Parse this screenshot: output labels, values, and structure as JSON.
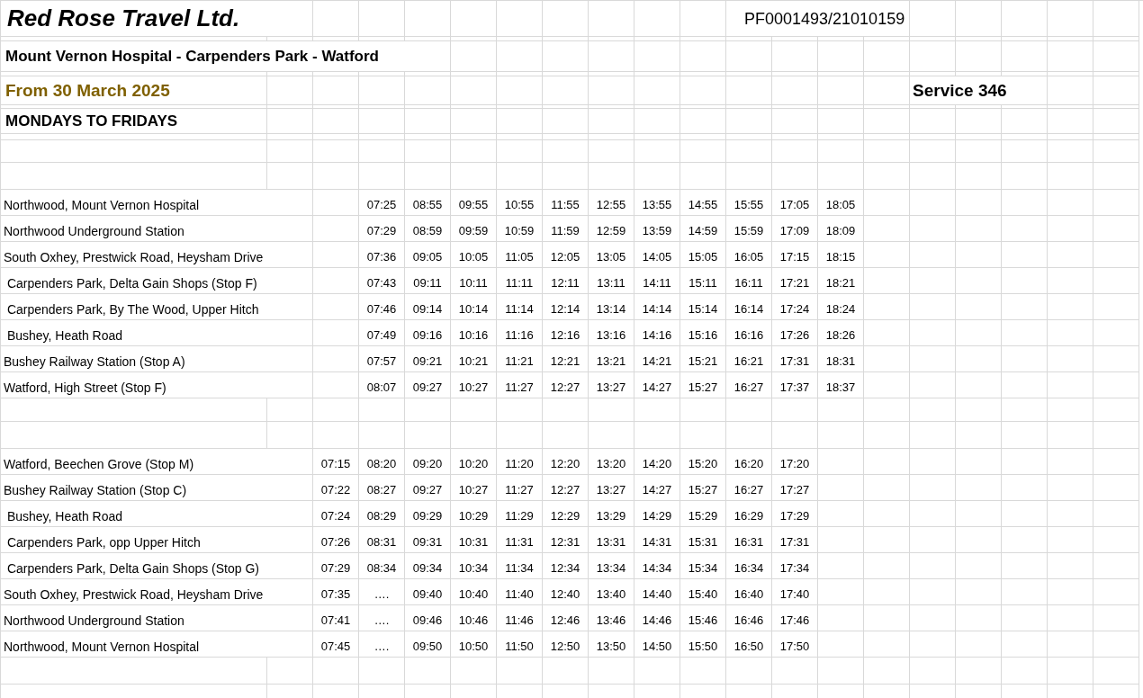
{
  "title": "Red Rose Travel Ltd.",
  "reference": "PF0001493/21010159",
  "route": "Mount Vernon Hospital - Carpenders Park - Watford",
  "effective_date": "From 30 March 2025",
  "service": "Service 346",
  "days": "MONDAYS TO FRIDAYS",
  "sections": [
    {
      "rows": [
        {
          "stop": "Northwood, Mount Vernon Hospital",
          "times": [
            "07:25",
            "08:55",
            "09:55",
            "10:55",
            "11:55",
            "12:55",
            "13:55",
            "14:55",
            "15:55",
            "17:05",
            "18:05"
          ]
        },
        {
          "stop": "Northwood Underground Station",
          "times": [
            "07:29",
            "08:59",
            "09:59",
            "10:59",
            "11:59",
            "12:59",
            "13:59",
            "14:59",
            "15:59",
            "17:09",
            "18:09"
          ]
        },
        {
          "stop": "South Oxhey, Prestwick Road, Heysham Drive",
          "times": [
            "07:36",
            "09:05",
            "10:05",
            "11:05",
            "12:05",
            "13:05",
            "14:05",
            "15:05",
            "16:05",
            "17:15",
            "18:15"
          ]
        },
        {
          "stop": " Carpenders Park, Delta Gain Shops (Stop F)",
          "times": [
            "07:43",
            "09:11",
            "10:11",
            "11:11",
            "12:11",
            "13:11",
            "14:11",
            "15:11",
            "16:11",
            "17:21",
            "18:21"
          ]
        },
        {
          "stop": " Carpenders Park, By The Wood, Upper Hitch",
          "times": [
            "07:46",
            "09:14",
            "10:14",
            "11:14",
            "12:14",
            "13:14",
            "14:14",
            "15:14",
            "16:14",
            "17:24",
            "18:24"
          ]
        },
        {
          "stop": " Bushey, Heath Road",
          "times": [
            "07:49",
            "09:16",
            "10:16",
            "11:16",
            "12:16",
            "13:16",
            "14:16",
            "15:16",
            "16:16",
            "17:26",
            "18:26"
          ]
        },
        {
          "stop": "Bushey Railway Station (Stop A)",
          "times": [
            "07:57",
            "09:21",
            "10:21",
            "11:21",
            "12:21",
            "13:21",
            "14:21",
            "15:21",
            "16:21",
            "17:31",
            "18:31"
          ]
        },
        {
          "stop": "Watford, High Street (Stop F)",
          "times": [
            "08:07",
            "09:27",
            "10:27",
            "11:27",
            "12:27",
            "13:27",
            "14:27",
            "15:27",
            "16:27",
            "17:37",
            "18:37"
          ]
        }
      ]
    },
    {
      "rows": [
        {
          "stop": "Watford, Beechen Grove (Stop M)",
          "times": [
            "07:15",
            "08:20",
            "09:20",
            "10:20",
            "11:20",
            "12:20",
            "13:20",
            "14:20",
            "15:20",
            "16:20",
            "17:20"
          ]
        },
        {
          "stop": "Bushey Railway Station (Stop C)",
          "times": [
            "07:22",
            "08:27",
            "09:27",
            "10:27",
            "11:27",
            "12:27",
            "13:27",
            "14:27",
            "15:27",
            "16:27",
            "17:27"
          ]
        },
        {
          "stop": " Bushey, Heath Road",
          "times": [
            "07:24",
            "08:29",
            "09:29",
            "10:29",
            "11:29",
            "12:29",
            "13:29",
            "14:29",
            "15:29",
            "16:29",
            "17:29"
          ]
        },
        {
          "stop": " Carpenders Park, opp Upper Hitch",
          "times": [
            "07:26",
            "08:31",
            "09:31",
            "10:31",
            "11:31",
            "12:31",
            "13:31",
            "14:31",
            "15:31",
            "16:31",
            "17:31"
          ]
        },
        {
          "stop": " Carpenders Park, Delta Gain Shops (Stop G)",
          "times": [
            "07:29",
            "08:34",
            "09:34",
            "10:34",
            "11:34",
            "12:34",
            "13:34",
            "14:34",
            "15:34",
            "16:34",
            "17:34"
          ]
        },
        {
          "stop": "South Oxhey, Prestwick Road, Heysham Drive",
          "times": [
            "07:35",
            "….",
            "09:40",
            "10:40",
            "11:40",
            "12:40",
            "13:40",
            "14:40",
            "15:40",
            "16:40",
            "17:40"
          ]
        },
        {
          "stop": "Northwood Underground Station",
          "times": [
            "07:41",
            "….",
            "09:46",
            "10:46",
            "11:46",
            "12:46",
            "13:46",
            "14:46",
            "15:46",
            "16:46",
            "17:46"
          ]
        },
        {
          "stop": "Northwood, Mount Vernon Hospital",
          "times": [
            "07:45",
            "….",
            "09:50",
            "10:50",
            "11:50",
            "12:50",
            "13:50",
            "14:50",
            "15:50",
            "16:50",
            "17:50"
          ]
        }
      ]
    }
  ]
}
